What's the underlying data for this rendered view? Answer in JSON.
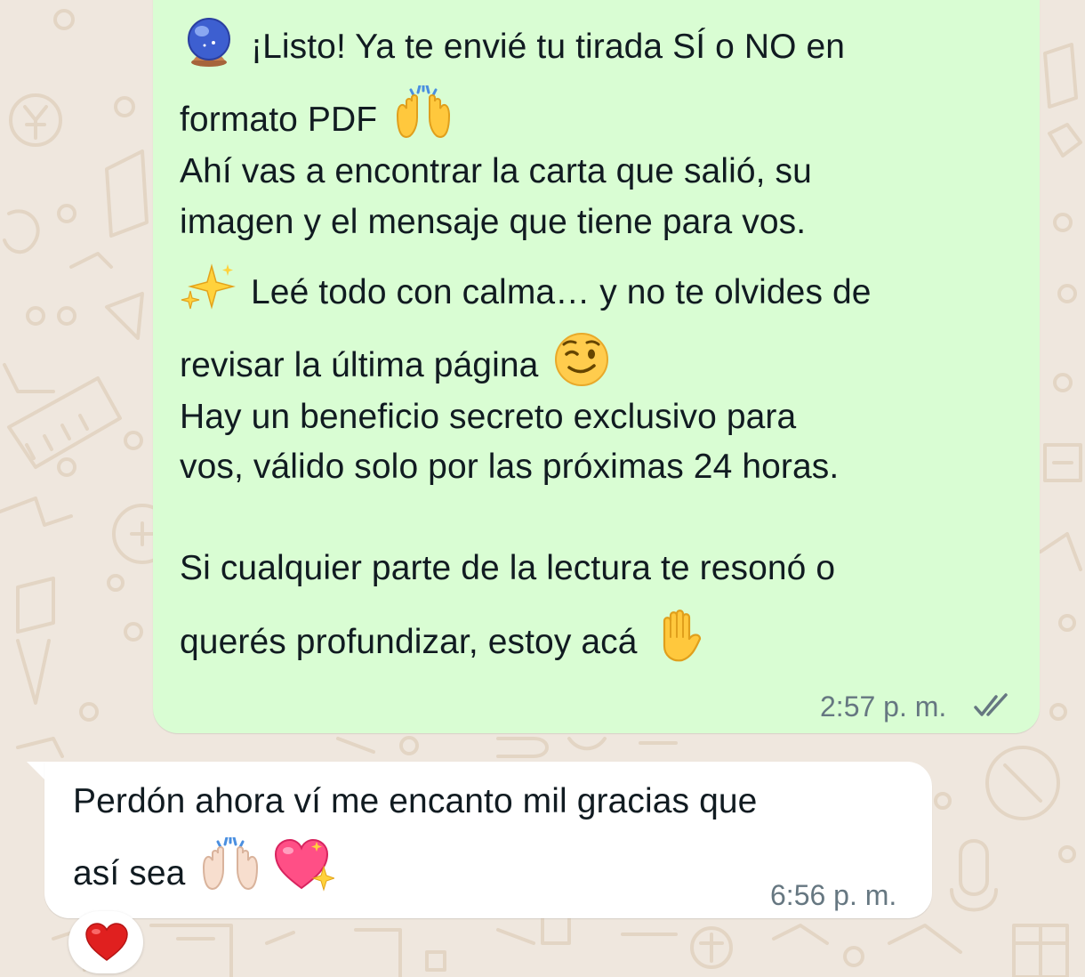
{
  "outgoing_message": {
    "lines": [
      "¡Listo! Ya te envié tu tirada SÍ o NO en",
      "formato PDF",
      "Ahí vas a encontrar la carta que salió, su",
      "imagen y el mensaje que tiene para vos.",
      "Leé todo con calma… y no te olvides de",
      "revisar la última página",
      "Hay un beneficio secreto exclusivo para",
      "vos, válido solo por las próximas 24 horas.",
      "Si cualquier parte de la lectura te resonó o",
      "querés profundizar, estoy acá"
    ],
    "time": "2:57 p. m.",
    "status": "read-double-check"
  },
  "incoming_message": {
    "lines": [
      "Perdón ahora ví me encanto mil gracias que",
      "así sea"
    ],
    "time": "6:56 p. m."
  },
  "reaction": {
    "emoji": "❤️"
  },
  "colors": {
    "outgoing_bubble": "#d9fdd3",
    "incoming_bubble": "#ffffff",
    "wallpaper": "#efe7de",
    "doodles": "#e3d5c4",
    "meta_text": "#667781",
    "message_text": "#111b21"
  }
}
